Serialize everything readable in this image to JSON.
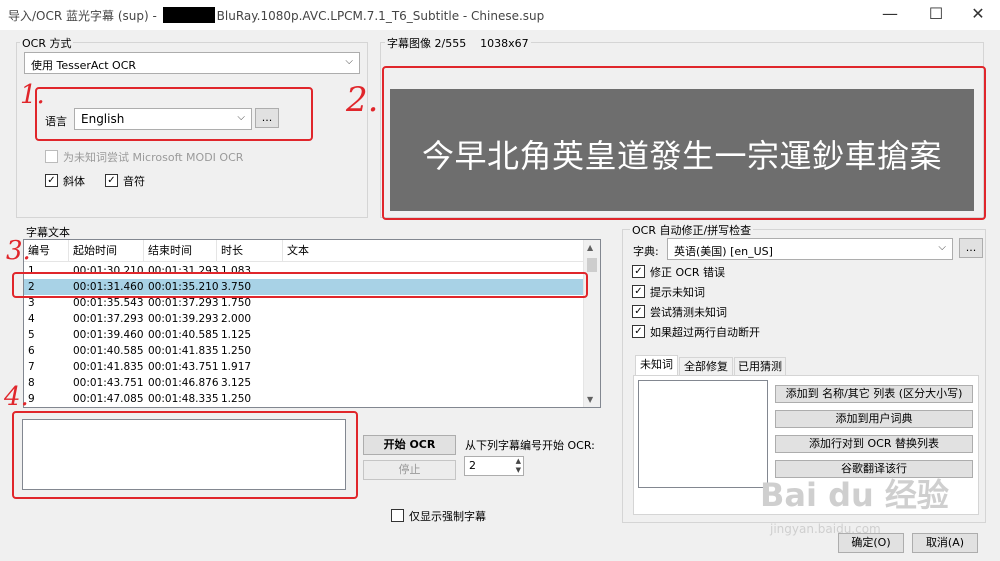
{
  "window": {
    "title_prefix": "导入/OCR 蓝光字幕 (sup) - ",
    "title_suffix": "BluRay.1080p.AVC.LPCM.7.1_T6_Subtitle - Chinese.sup",
    "minimize": "—",
    "maximize": "☐",
    "close": "✕"
  },
  "ocr_method": {
    "group_label": "OCR 方式",
    "selected": "使用 TesserAct OCR",
    "language_label": "语言",
    "language_value": "English",
    "browse_label": "...",
    "modi_label": "为未知词尝试 Microsoft MODI OCR",
    "italic_label": "斜体",
    "italic_checked": true,
    "music_label": "音符",
    "music_checked": true
  },
  "image_panel": {
    "label": "字幕图像 2/555    1038x67",
    "subtitle_text": "今早北角英皇道發生一宗運鈔車搶案"
  },
  "subtitle_text": {
    "group_label": "字幕文本",
    "columns": [
      "编号",
      "起始时间",
      "结束时间",
      "时长",
      "文本"
    ],
    "rows": [
      {
        "num": "1",
        "start": "00:01:30.210",
        "end": "00:01:31.293",
        "dur": "1.083",
        "text": ""
      },
      {
        "num": "2",
        "start": "00:01:31.460",
        "end": "00:01:35.210",
        "dur": "3.750",
        "text": "",
        "selected": true
      },
      {
        "num": "3",
        "start": "00:01:35.543",
        "end": "00:01:37.293",
        "dur": "1.750",
        "text": ""
      },
      {
        "num": "4",
        "start": "00:01:37.293",
        "end": "00:01:39.293",
        "dur": "2.000",
        "text": ""
      },
      {
        "num": "5",
        "start": "00:01:39.460",
        "end": "00:01:40.585",
        "dur": "1.125",
        "text": ""
      },
      {
        "num": "6",
        "start": "00:01:40.585",
        "end": "00:01:41.835",
        "dur": "1.250",
        "text": ""
      },
      {
        "num": "7",
        "start": "00:01:41.835",
        "end": "00:01:43.751",
        "dur": "1.917",
        "text": ""
      },
      {
        "num": "8",
        "start": "00:01:43.751",
        "end": "00:01:46.876",
        "dur": "3.125",
        "text": ""
      },
      {
        "num": "9",
        "start": "00:01:47.085",
        "end": "00:01:48.335",
        "dur": "1.250",
        "text": ""
      }
    ]
  },
  "ocr_controls": {
    "start_label": "开始 OCR",
    "stop_label": "停止",
    "start_from_label": "从下列字幕编号开始 OCR:",
    "start_from_value": "2",
    "forced_only_label": "仅显示强制字幕"
  },
  "autocorrect": {
    "group_label": "OCR 自动修正/拼写检查",
    "dict_label": "字典:",
    "dict_value": "英语(美国) [en_US]",
    "dict_browse": "...",
    "checks": [
      {
        "label": "修正 OCR 错误",
        "checked": true
      },
      {
        "label": "提示未知词",
        "checked": true
      },
      {
        "label": "尝试猜测未知词",
        "checked": true
      },
      {
        "label": "如果超过两行自动断开",
        "checked": true
      }
    ],
    "tabs": [
      "未知词",
      "全部修复",
      "已用猜测"
    ],
    "buttons": [
      "添加到 名称/其它 列表 (区分大小写)",
      "添加到用户词典",
      "添加行对到 OCR 替换列表",
      "谷歌翻译该行"
    ]
  },
  "footer": {
    "ok_label": "确定(O)",
    "cancel_label": "取消(A)"
  },
  "annotations": [
    "1.",
    "2.",
    "3.",
    "4."
  ],
  "watermark": {
    "main": "Bai du 经验",
    "sub": "jingyan.baidu.com"
  }
}
